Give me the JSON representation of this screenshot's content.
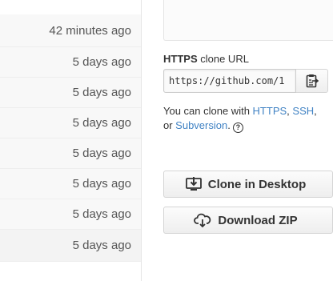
{
  "file_ages": {
    "items": [
      "42 minutes ago",
      "5 days ago",
      "5 days ago",
      "5 days ago",
      "5 days ago",
      "5 days ago",
      "5 days ago",
      "5 days ago"
    ]
  },
  "clone_panel": {
    "title_bold": "HTTPS",
    "title_rest": " clone URL",
    "url_value": "https://github.com/1",
    "help": {
      "prefix": "You can clone with ",
      "https": "HTTPS",
      "sep1": ", ",
      "ssh": "SSH",
      "sep2": ",",
      "or": " or ",
      "subversion": "Subversion",
      "suffix": "."
    },
    "clone_desktop_label": "Clone in Desktop",
    "download_zip_label": "Download ZIP"
  },
  "icons": {
    "copy": "clipboard-icon",
    "help": "question-circle-icon",
    "desktop": "desktop-download-icon",
    "zip": "cloud-download-icon"
  },
  "colors": {
    "link": "#4183c4",
    "text": "#333333",
    "muted": "#555555"
  }
}
